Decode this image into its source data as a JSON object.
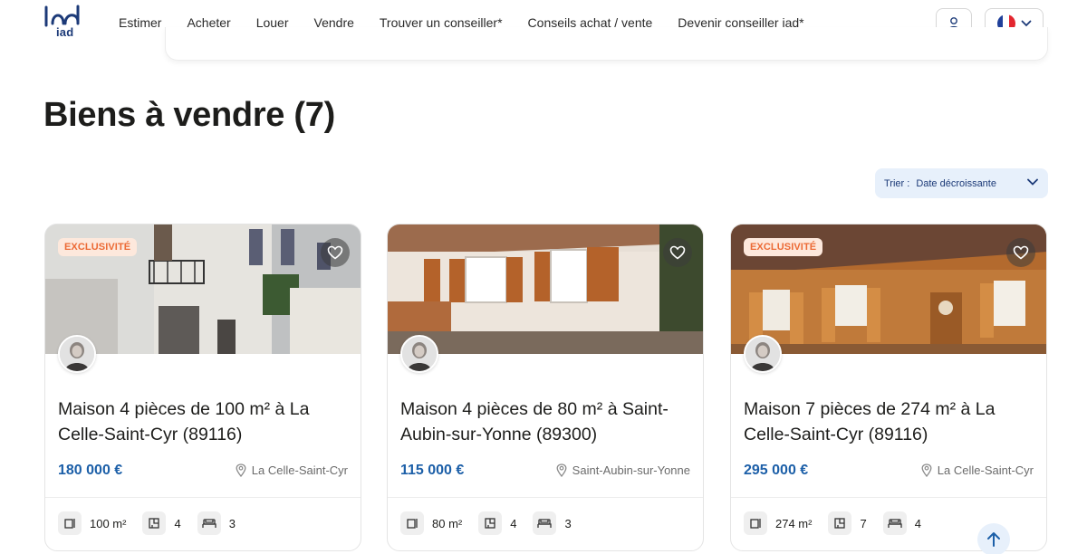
{
  "header": {
    "logo_text": "iad",
    "nav": [
      "Estimer",
      "Acheter",
      "Louer",
      "Vendre",
      "Trouver un conseiller*",
      "Conseils achat / vente",
      "Devenir conseiller iad*"
    ]
  },
  "page": {
    "title": "Biens à vendre (7)"
  },
  "sort": {
    "label": "Trier :",
    "value": "Date décroissante"
  },
  "colors": {
    "brand": "#1c3a78",
    "price": "#1c5fa8",
    "badge_text": "#ec6a35",
    "badge_bg": "#fde8dc"
  },
  "listings": [
    {
      "badge": "EXCLUSIVITÉ",
      "title": "Maison 4 pièces de 100 m² à La Celle-Saint-Cyr (89116)",
      "price": "180 000 €",
      "location": "La Celle-Saint-Cyr",
      "surface": "100 m²",
      "rooms": "4",
      "bedrooms": "3"
    },
    {
      "badge": "",
      "title": "Maison 4 pièces de 80 m² à Saint-Aubin-sur-Yonne (89300)",
      "price": "115 000 €",
      "location": "Saint-Aubin-sur-Yonne",
      "surface": "80 m²",
      "rooms": "4",
      "bedrooms": "3"
    },
    {
      "badge": "EXCLUSIVITÉ",
      "title": "Maison 7 pièces de 274 m² à La Celle-Saint-Cyr (89116)",
      "price": "295 000 €",
      "location": "La Celle-Saint-Cyr",
      "surface": "274 m²",
      "rooms": "7",
      "bedrooms": "4"
    }
  ]
}
